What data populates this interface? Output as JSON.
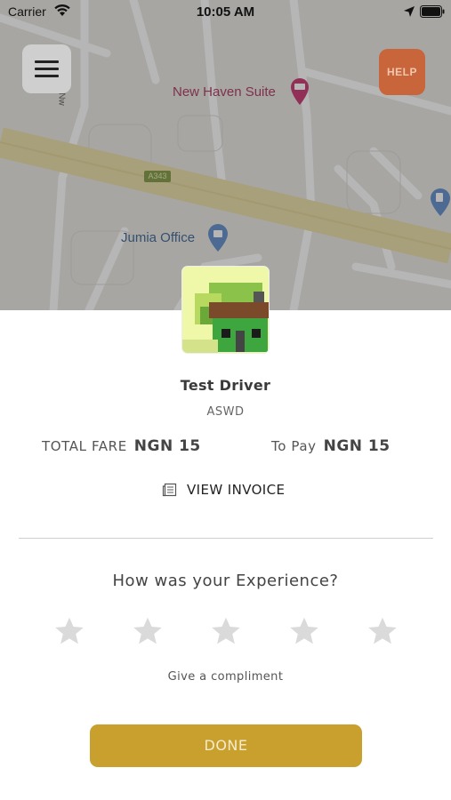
{
  "status_bar": {
    "carrier": "Carrier",
    "time": "10:05 AM"
  },
  "map": {
    "poi_hotel": "New Haven Suite",
    "poi_office": "Jumia Office",
    "road_code": "A343",
    "road_fragment": "Nw",
    "help_label": "HELP"
  },
  "driver": {
    "name": "Test Driver",
    "vehicle": "ASWD"
  },
  "fare": {
    "total_label": "TOTAL FARE",
    "total_value": "NGN 15",
    "pay_label": "To Pay",
    "pay_value": "NGN 15"
  },
  "invoice": {
    "label": "VIEW INVOICE",
    "icon": "document-icon"
  },
  "rating": {
    "question": "How was your Experience?",
    "max_stars": 5,
    "selected": 0,
    "compliment": "Give a compliment"
  },
  "done_label": "DONE",
  "colors": {
    "accent": "#c9a02e",
    "help": "#c8653a",
    "star_empty": "#dadada",
    "hotel_pin": "#c2185b",
    "office_pin": "#4a7fc1"
  }
}
